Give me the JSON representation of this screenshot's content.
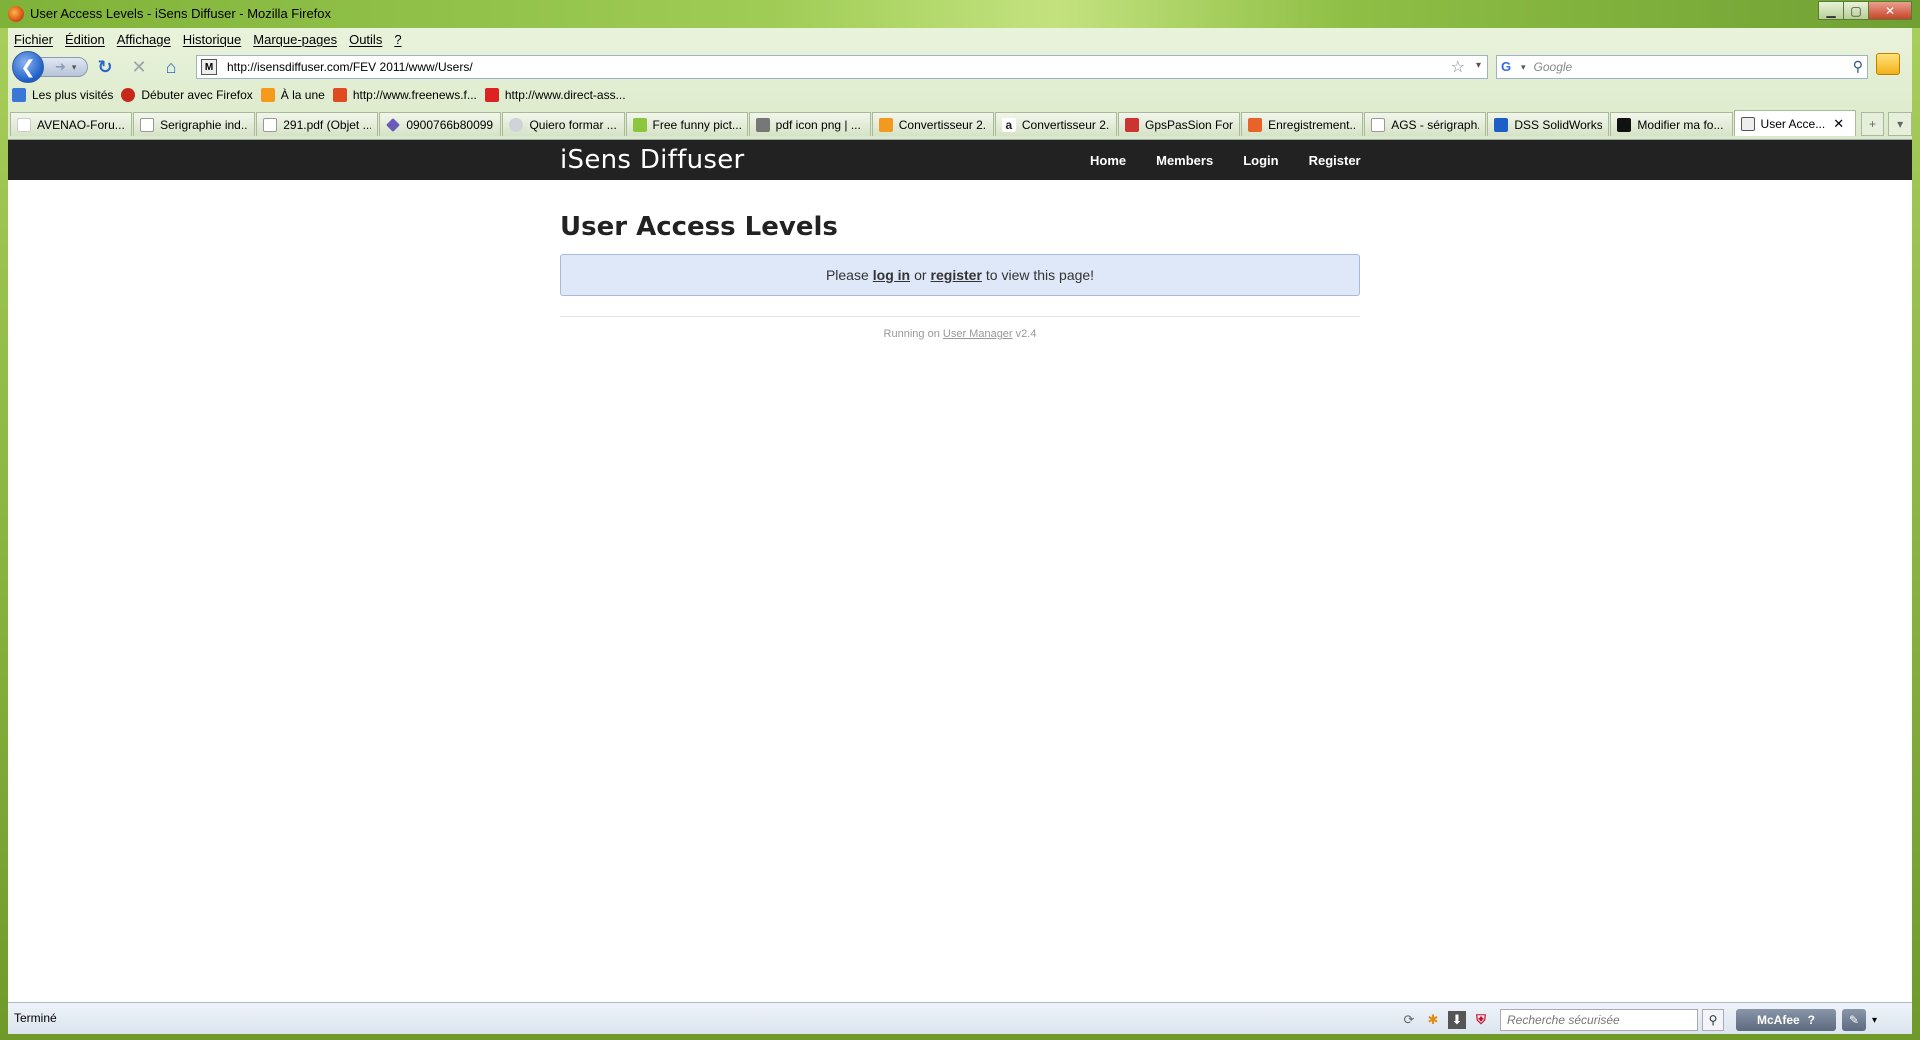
{
  "window": {
    "title": "User Access Levels - iSens Diffuser - Mozilla Firefox"
  },
  "menu": [
    "Fichier",
    "Édition",
    "Affichage",
    "Historique",
    "Marque-pages",
    "Outils",
    "?"
  ],
  "address": {
    "url": "http://isensdiffuser.com/FEV 2011/www/Users/"
  },
  "search": {
    "placeholder": "Google"
  },
  "bookmarks": [
    {
      "label": "Les plus visités",
      "icon": "bookmark-star-icon",
      "color": "#3a78d8"
    },
    {
      "label": "Débuter avec Firefox",
      "icon": "firefox-icon",
      "color": "#c8281a"
    },
    {
      "label": "À la une",
      "icon": "rss-icon",
      "color": "#f59a1d"
    },
    {
      "label": "http://www.freenews.f...",
      "icon": "freenews-icon",
      "color": "#e04a20"
    },
    {
      "label": "http://www.direct-ass...",
      "icon": "direct-assurance-icon",
      "color": "#d22"
    }
  ],
  "tabs": [
    {
      "label": "AVENAO-Foru...",
      "color": "#ffffff"
    },
    {
      "label": "Serigraphie ind...",
      "color": "#ffffff"
    },
    {
      "label": "291.pdf (Objet ...",
      "color": "#ffffff"
    },
    {
      "label": "0900766b80099...",
      "color": "#6b5bb8"
    },
    {
      "label": "Quiero formar ...",
      "color": "#cfd4da"
    },
    {
      "label": "Free funny pict...",
      "color": "#8cc63f"
    },
    {
      "label": "pdf icon png | ...",
      "color": "#777777"
    },
    {
      "label": "Convertisseur 2...",
      "color": "#f29a1f"
    },
    {
      "label": "Convertisseur 2...",
      "color": "#222222"
    },
    {
      "label": "GpsPasSion For...",
      "color": "#cc3333"
    },
    {
      "label": "Enregistrement...",
      "color": "#e8632a"
    },
    {
      "label": "AGS - sérigraph...",
      "color": "#ffffff"
    },
    {
      "label": "DSS SolidWorks...",
      "color": "#1e5fc7"
    },
    {
      "label": "Modifier ma fo...",
      "color": "#111111"
    },
    {
      "label": "User Acce...",
      "color": "#ffffff",
      "active": true
    }
  ],
  "site": {
    "brand": "iSens Diffuser",
    "nav": [
      "Home",
      "Members",
      "Login",
      "Register"
    ],
    "page_title": "User Access Levels",
    "alert": {
      "prefix": "Please",
      "login_link": "log in",
      "middle": "or",
      "register_link": "register",
      "suffix": "to view this page!"
    },
    "footer": {
      "prefix": "Running on",
      "link": "User Manager",
      "version": "v2.4"
    },
    "colors": {
      "navbar_bg": "#222222",
      "alert_bg": "#dfe8f9",
      "alert_border": "#aab9d9"
    }
  },
  "status": {
    "text": "Terminé",
    "safe_search_placeholder": "Recherche sécurisée",
    "mcafee_label": "McAfee"
  }
}
